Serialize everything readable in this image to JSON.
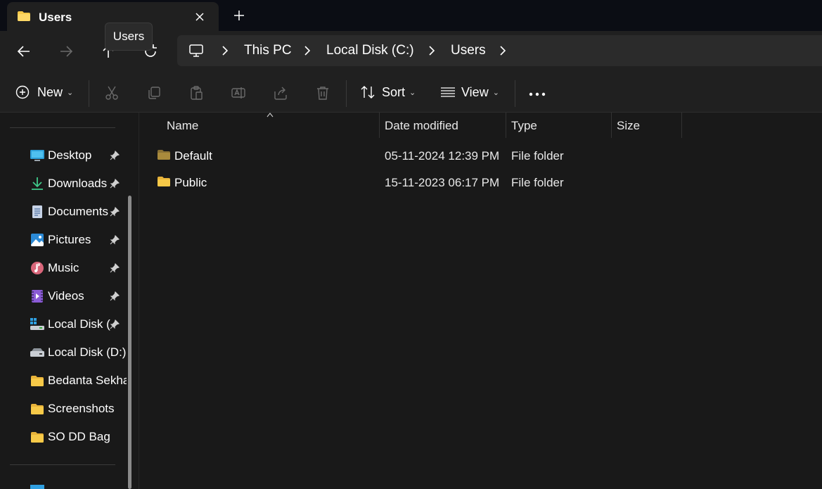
{
  "window": {
    "tab_title": "Users",
    "tooltip": "Users"
  },
  "address": {
    "crumbs": [
      "This PC",
      "Local Disk (C:)",
      "Users"
    ]
  },
  "commands": {
    "new_label": "New",
    "sort_label": "Sort",
    "view_label": "View"
  },
  "sidebar": {
    "items": [
      {
        "label": "Desktop",
        "icon": "desktop-icon",
        "pinned": true
      },
      {
        "label": "Downloads",
        "icon": "download-icon",
        "pinned": true
      },
      {
        "label": "Documents",
        "icon": "document-icon",
        "pinned": true
      },
      {
        "label": "Pictures",
        "icon": "pictures-icon",
        "pinned": true
      },
      {
        "label": "Music",
        "icon": "music-icon",
        "pinned": true
      },
      {
        "label": "Videos",
        "icon": "videos-icon",
        "pinned": true
      },
      {
        "label": "Local Disk (",
        "icon": "drive-c-icon",
        "pinned": true
      },
      {
        "label": "Local Disk (D:)",
        "icon": "drive-icon",
        "pinned": false
      },
      {
        "label": "Bedanta Sekha",
        "icon": "folder-icon",
        "pinned": false
      },
      {
        "label": "Screenshots",
        "icon": "folder-icon",
        "pinned": false
      },
      {
        "label": "SO DD Bag",
        "icon": "folder-icon",
        "pinned": false
      }
    ]
  },
  "columns": {
    "name": "Name",
    "date": "Date modified",
    "type": "Type",
    "size": "Size"
  },
  "files": [
    {
      "name": "Default",
      "date": "05-11-2024 12:39 PM",
      "type": "File folder",
      "dim": true
    },
    {
      "name": "Public",
      "date": "15-11-2023 06:17 PM",
      "type": "File folder",
      "dim": false
    }
  ],
  "colors": {
    "folder": "#f7c948",
    "folder_dim": "#a98a3c",
    "accent": "#4cc2ff"
  }
}
